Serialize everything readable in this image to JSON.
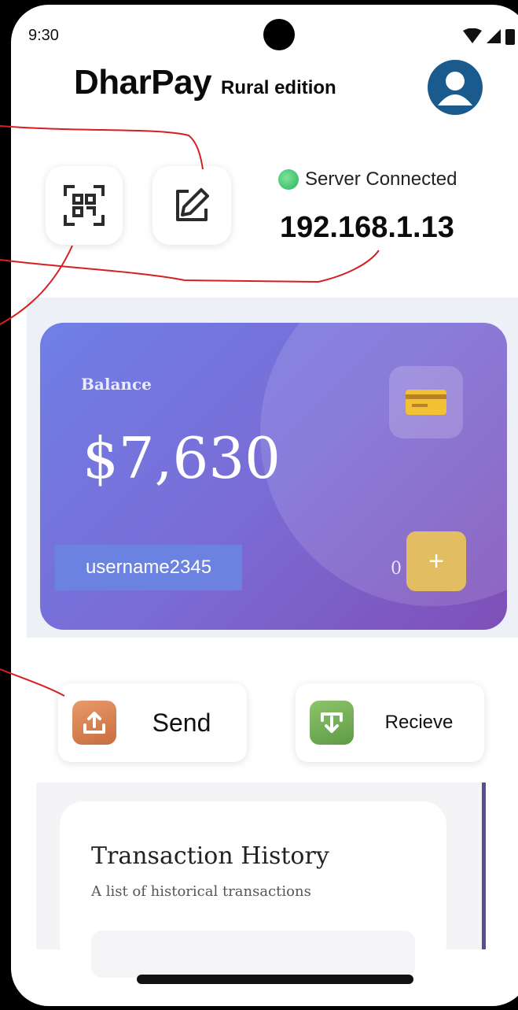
{
  "status_bar": {
    "time": "9:30"
  },
  "header": {
    "brand": "DharPay",
    "edition": "Rural edition"
  },
  "toolbar": {
    "qr_icon": "qr-scan-icon",
    "edit_icon": "edit-icon"
  },
  "server": {
    "status_text": "Server Connected",
    "ip": "192.168.1.13",
    "status_color": "#2fbf5f"
  },
  "card": {
    "label": "Balance",
    "balance": "$7,630",
    "username": "username2345",
    "partial_text": "0",
    "add_label": "+"
  },
  "actions": {
    "send_label": "Send",
    "receive_label": "Recieve"
  },
  "history": {
    "title": "Transaction History",
    "subtitle": "A list of historical transactions"
  },
  "colors": {
    "accent": "#6f7fe6",
    "annotation": "#d62020",
    "add_button": "#e2bd62"
  }
}
